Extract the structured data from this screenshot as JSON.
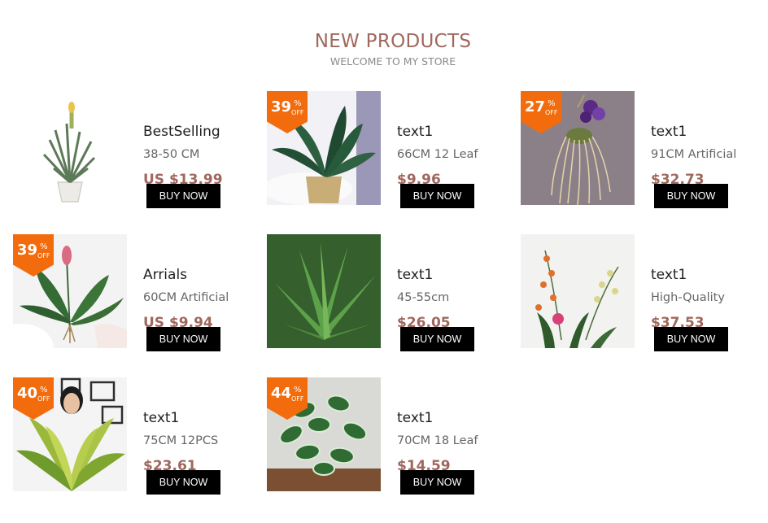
{
  "header": {
    "title": "NEW PRODUCTS",
    "subtitle": "WELCOME TO MY STORE"
  },
  "colors": {
    "accent": "#a0685d",
    "badge": "#f26b0c",
    "button": "#000000"
  },
  "badge_labels": {
    "percent": "%",
    "off": "OFF"
  },
  "products": [
    {
      "name": "BestSelling",
      "desc": "38-50 CM",
      "price": "US $13.99",
      "discount": null,
      "button": "BUY NOW",
      "image": "air-plant-pot"
    },
    {
      "name": "text1",
      "desc": "66CM 12 Leaf",
      "price": "$9.96",
      "discount": "39",
      "button": "BUY NOW",
      "image": "palm-in-basket"
    },
    {
      "name": "text1",
      "desc": "91CM Artificial",
      "price": "$32.73",
      "discount": "27",
      "button": "BUY NOW",
      "image": "hanging-orchid"
    },
    {
      "name": "Arrials",
      "desc": "60CM Artificial",
      "price": "US $9.94",
      "discount": "39",
      "button": "BUY NOW",
      "image": "peace-lily"
    },
    {
      "name": "text1",
      "desc": "45-55cm",
      "price": "$26.05",
      "discount": null,
      "button": "BUY NOW",
      "image": "agave"
    },
    {
      "name": "text1",
      "desc": "High-Quality",
      "price": "$37.53",
      "discount": null,
      "button": "BUY NOW",
      "image": "orchid-arrangement"
    },
    {
      "name": "text1",
      "desc": "75CM 12PCS",
      "price": "$23.61",
      "discount": "40",
      "button": "BUY NOW",
      "image": "woman-with-leaves"
    },
    {
      "name": "text1",
      "desc": "70CM 18 Leaf",
      "price": "$14.59",
      "discount": "44",
      "button": "BUY NOW",
      "image": "dieffenbachia"
    }
  ]
}
